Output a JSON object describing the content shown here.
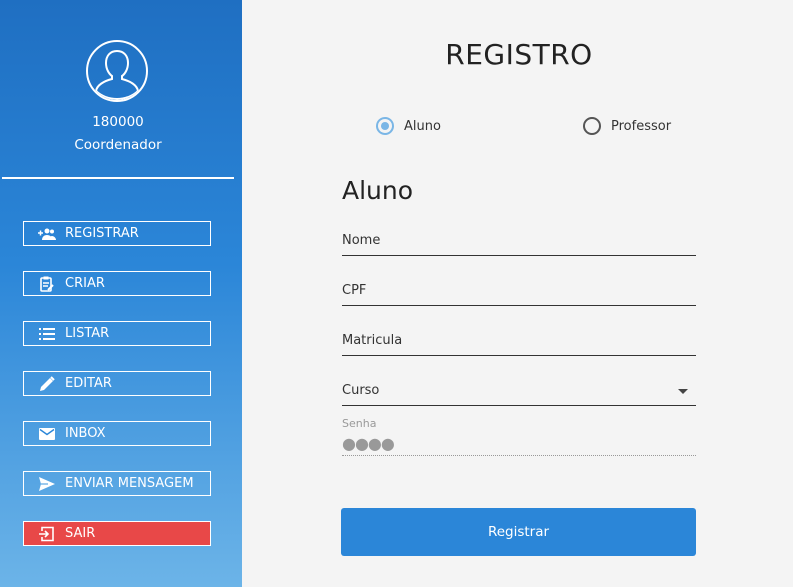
{
  "sidebar": {
    "user_id": "180000",
    "user_role": "Coordenador",
    "items": [
      {
        "label": "REGISTRAR",
        "icon": "add-group-icon"
      },
      {
        "label": "CRIAR",
        "icon": "clipboard-edit-icon"
      },
      {
        "label": "LISTAR",
        "icon": "list-icon"
      },
      {
        "label": "EDITAR",
        "icon": "pencil-icon"
      },
      {
        "label": "INBOX",
        "icon": "mail-icon"
      },
      {
        "label": "ENVIAR MENSAGEM",
        "icon": "send-icon"
      },
      {
        "label": "SAIR",
        "icon": "exit-icon"
      }
    ],
    "colors": {
      "gradient_top": "#1f6fc2",
      "gradient_bottom": "#6cb4e8",
      "exit": "#e84848"
    }
  },
  "form": {
    "title": "REGISTRO",
    "options": [
      {
        "label": "Aluno",
        "checked": true
      },
      {
        "label": "Professor",
        "checked": false
      }
    ],
    "section_title": "Aluno",
    "fields": {
      "nome": "Nome",
      "cpf": "CPF",
      "matricula": "Matricula",
      "curso": "Curso"
    },
    "senha_label": "Senha",
    "senha_value": "●●●●",
    "submit_label": "Registrar",
    "accent": "#2b86d8"
  }
}
